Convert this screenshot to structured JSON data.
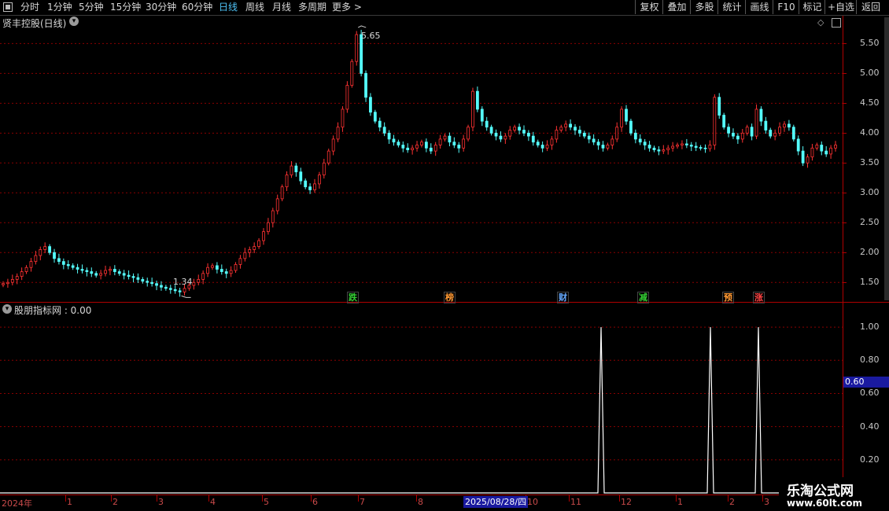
{
  "toolbar": {
    "left_items": [
      "分时",
      "1分钟",
      "5分钟",
      "15分钟",
      "30分钟",
      "60分钟",
      "日线",
      "周线",
      "月线",
      "多周期",
      "更多 >"
    ],
    "active_item": "日线",
    "right_items": [
      "复权",
      "叠加",
      "多股",
      "统计",
      "画线",
      "F10",
      "标记",
      "+自选",
      "返回"
    ]
  },
  "main_panel": {
    "title": "贤丰控股(日线)",
    "high_label": "5.65",
    "low_label": "1.34",
    "y_ticks": [
      "5.50",
      "5.00",
      "4.50",
      "4.00",
      "3.50",
      "3.00",
      "2.50",
      "2.00",
      "1.50"
    ],
    "signals": [
      {
        "text": "跌",
        "color": "#33cc33"
      },
      {
        "text": "榜",
        "color": "#ff9933"
      },
      {
        "text": "财",
        "color": "#66aaff"
      },
      {
        "text": "减",
        "color": "#33cc33"
      },
      {
        "text": "预",
        "color": "#ff9933"
      },
      {
        "text": "涨",
        "color": "#ff4444"
      }
    ]
  },
  "indicator_panel": {
    "title": "股朋指标网 : 0.00",
    "y_ticks": [
      "1.00",
      "0.80",
      "0.60",
      "0.40",
      "0.20"
    ],
    "current_value": "0.60"
  },
  "time_axis": {
    "year_label": "2024年",
    "months": [
      "1",
      "2",
      "3",
      "4",
      "5",
      "6",
      "7",
      "8",
      "10",
      "11",
      "12",
      "1",
      "2",
      "3"
    ],
    "cursor_date": "2025/08/28/四"
  },
  "watermark": {
    "line1": "乐淘公式网",
    "line2": "www.60lt.com"
  },
  "colors": {
    "up": "#ff3232",
    "down": "#54fcfc",
    "grid": "#b00000",
    "indicator_line": "#ffffff",
    "cursor_bg": "#1a1aa0"
  },
  "chart_data": {
    "type": "candlestick",
    "price_axis": {
      "ylim": [
        1.2,
        5.9
      ],
      "ticks": [
        1.5,
        2.0,
        2.5,
        3.0,
        3.5,
        4.0,
        4.5,
        5.0,
        5.5
      ]
    },
    "close_series": [
      1.48,
      1.5,
      1.55,
      1.6,
      1.68,
      1.75,
      1.85,
      1.95,
      2.05,
      2.1,
      2.0,
      1.9,
      1.85,
      1.8,
      1.78,
      1.75,
      1.72,
      1.7,
      1.68,
      1.65,
      1.62,
      1.65,
      1.7,
      1.72,
      1.68,
      1.65,
      1.62,
      1.6,
      1.58,
      1.55,
      1.52,
      1.5,
      1.48,
      1.45,
      1.42,
      1.4,
      1.38,
      1.36,
      1.34,
      1.4,
      1.45,
      1.5,
      1.55,
      1.65,
      1.75,
      1.78,
      1.72,
      1.68,
      1.65,
      1.7,
      1.8,
      1.9,
      2.0,
      2.05,
      2.1,
      2.2,
      2.35,
      2.5,
      2.7,
      2.9,
      3.1,
      3.3,
      3.45,
      3.35,
      3.2,
      3.1,
      3.05,
      3.15,
      3.3,
      3.5,
      3.7,
      3.9,
      4.1,
      4.4,
      4.8,
      5.2,
      5.65,
      5.0,
      4.6,
      4.35,
      4.2,
      4.1,
      4.0,
      3.9,
      3.85,
      3.8,
      3.75,
      3.72,
      3.75,
      3.8,
      3.85,
      3.75,
      3.7,
      3.8,
      3.9,
      3.95,
      3.85,
      3.8,
      3.75,
      3.9,
      4.1,
      4.7,
      4.4,
      4.2,
      4.1,
      4.0,
      3.95,
      3.9,
      3.95,
      4.05,
      4.1,
      4.05,
      4.0,
      3.95,
      3.85,
      3.8,
      3.75,
      3.8,
      3.9,
      4.05,
      4.1,
      4.15,
      4.1,
      4.05,
      4.0,
      3.95,
      3.9,
      3.85,
      3.8,
      3.75,
      3.8,
      3.9,
      4.1,
      4.4,
      4.2,
      4.0,
      3.9,
      3.85,
      3.8,
      3.75,
      3.72,
      3.7,
      3.72,
      3.75,
      3.78,
      3.8,
      3.82,
      3.8,
      3.78,
      3.76,
      3.75,
      3.74,
      3.8,
      4.6,
      4.3,
      4.1,
      4.0,
      3.95,
      3.9,
      4.0,
      4.1,
      3.95,
      4.4,
      4.2,
      4.05,
      3.95,
      4.0,
      4.1,
      4.15,
      4.1,
      3.9,
      3.7,
      3.5,
      3.6,
      3.75,
      3.8,
      3.7,
      3.65,
      3.75,
      3.8
    ],
    "indicator_peaks": [
      {
        "x_label": "11-12 boundary",
        "value": 1.0
      },
      {
        "x_label": "2",
        "value": 1.0
      },
      {
        "x_label": "3",
        "value": 1.0
      }
    ],
    "indicator_ylim": [
      0,
      1.1
    ]
  }
}
